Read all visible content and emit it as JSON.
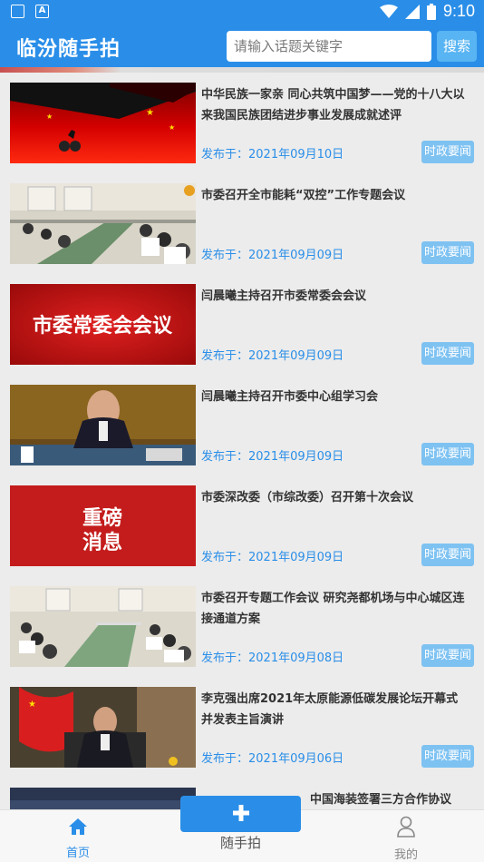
{
  "status_bar": {
    "time": "9:10",
    "notif_1": "",
    "notif_2": "A"
  },
  "app_bar": {
    "title": "临汾随手拍",
    "search_placeholder": "请输入话题关键字",
    "search_button": "搜索"
  },
  "news": [
    {
      "title": "中华民族一家亲 同心共筑中国梦——党的十八大以来我国民族团结进步事业发展成就述评",
      "date": "发布于：2021年09月10日",
      "tag": "时政要闻"
    },
    {
      "title": "市委召开全市能耗“双控”工作专题会议",
      "date": "发布于：2021年09月09日",
      "tag": "时政要闻"
    },
    {
      "title": "闫晨曦主持召开市委常委会会议",
      "date": "发布于：2021年09月09日",
      "tag": "时政要闻",
      "image_text": "市委常委会会议"
    },
    {
      "title": "闫晨曦主持召开市委中心组学习会",
      "date": "发布于：2021年09月09日",
      "tag": "时政要闻"
    },
    {
      "title": "市委深改委（市综改委）召开第十次会议",
      "date": "发布于：2021年09月09日",
      "tag": "时政要闻",
      "image_text_1": "重磅",
      "image_text_2": "消息"
    },
    {
      "title": "市委召开专题工作会议 研究尧都机场与中心城区连接通道方案",
      "date": "发布于：2021年09月08日",
      "tag": "时政要闻"
    },
    {
      "title": "李克强出席2021年太原能源低碳发展论坛开幕式并发表主旨演讲",
      "date": "发布于：2021年09月06日",
      "tag": "时政要闻"
    },
    {
      "title": "中国海装签署三方合作协议",
      "date": "",
      "tag": ""
    }
  ],
  "bottom_nav": {
    "home": "首页",
    "capture": "随手拍",
    "mine": "我的"
  },
  "colors": {
    "primary": "#2a8ee8",
    "tag": "#7ec2f2",
    "background": "#ececec"
  }
}
